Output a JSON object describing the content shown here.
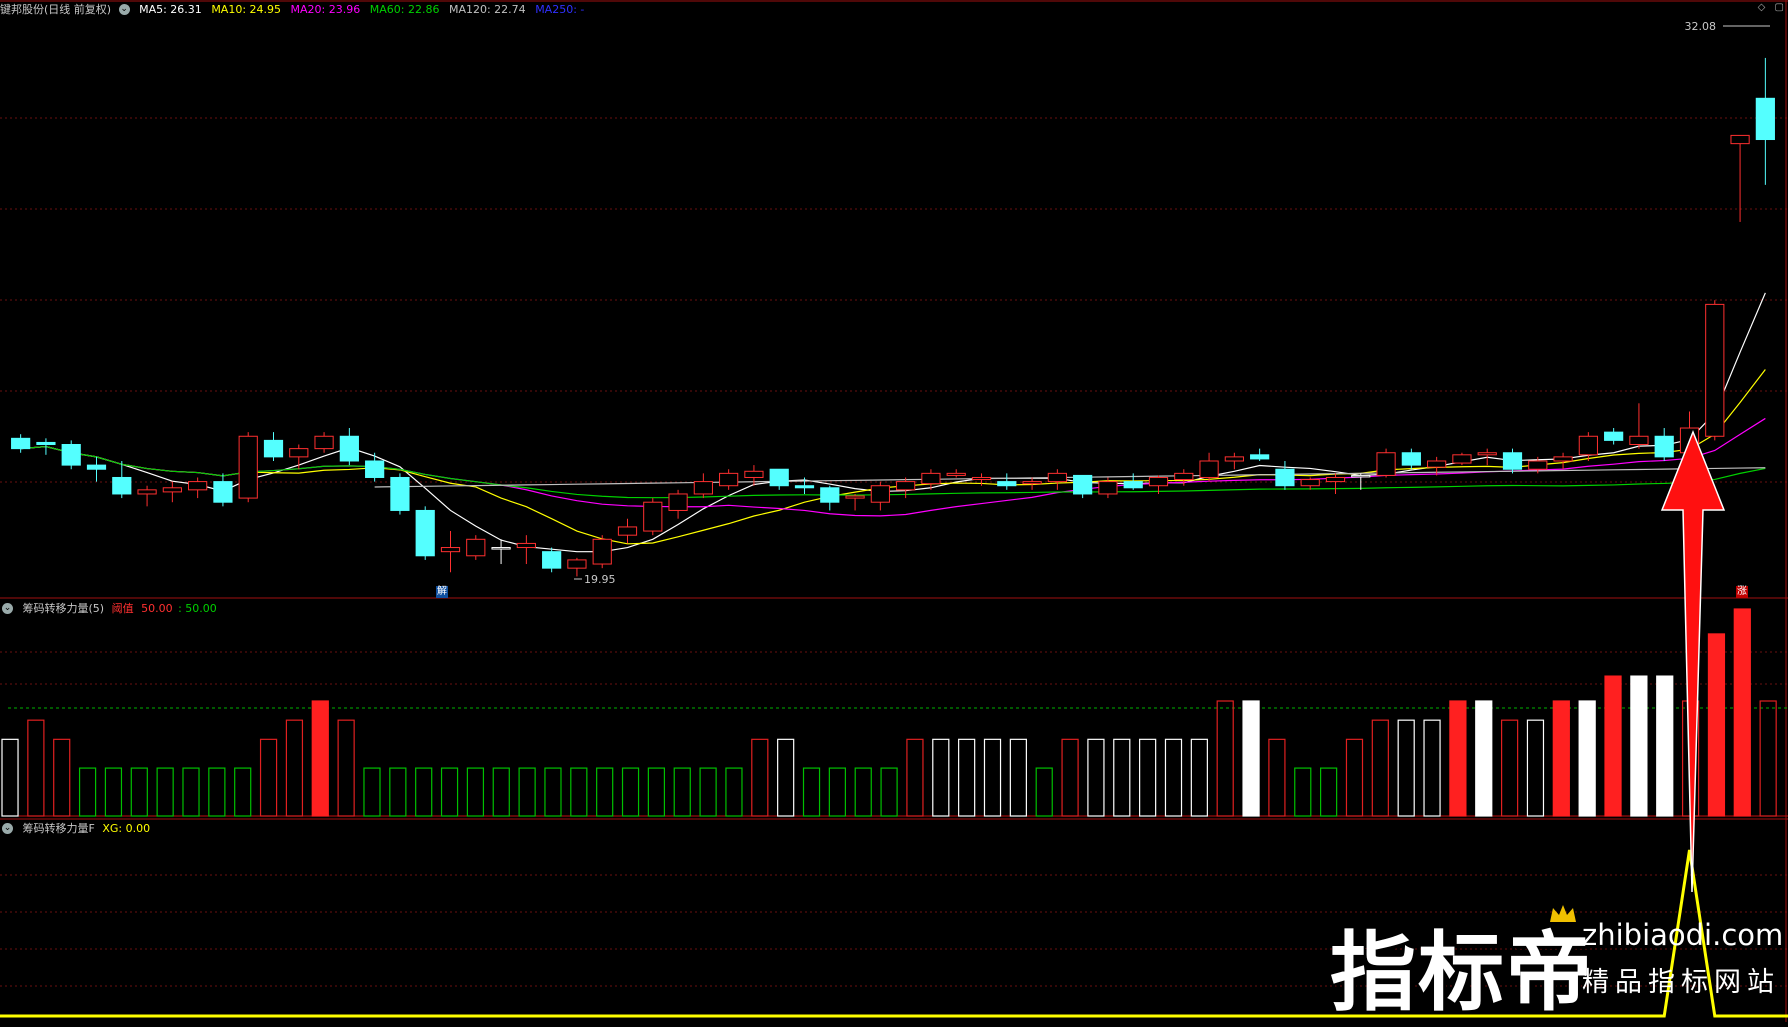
{
  "main_header": {
    "stock": "键邦股份(日线 前复权)",
    "ma5": "MA5: 26.31",
    "ma10": "MA10: 24.95",
    "ma20": "MA20: 23.96",
    "ma60": "MA60: 22.86",
    "ma120": "MA120: 22.74",
    "ma250": "MA250: -"
  },
  "price_labels": {
    "high": "32.08",
    "low": "19.95"
  },
  "markers": {
    "jie": "解",
    "zhang": "涨"
  },
  "ind1_header": {
    "name": "筹码转移力量(5)",
    "key": "阈值",
    "value_red": "50.00",
    "value_green": ": 50.00"
  },
  "ind2_header": {
    "name": "筹码转移力量F",
    "xg": "XG: 0.00"
  },
  "watermark": {
    "title": "指标帝",
    "url": "zhibiaodi.com",
    "sub": "精品指标网站"
  },
  "colors": {
    "up": "#ff3030",
    "down": "#54ffff",
    "ma5": "#ffffff",
    "ma10": "#ffff00",
    "ma20": "#ff00ff",
    "ma60": "#00d000",
    "ma120": "#c0c0c0",
    "ma250": "#3030ff"
  },
  "chart_data": [
    {
      "type": "candlestick",
      "title": "键邦股份(日线 前复权)",
      "y_range": [
        19.0,
        33.0
      ],
      "ohlc": [
        [
          22.85,
          22.95,
          22.5,
          22.6
        ],
        [
          22.75,
          22.85,
          22.45,
          22.7
        ],
        [
          22.7,
          22.8,
          22.1,
          22.2
        ],
        [
          22.2,
          22.4,
          21.8,
          22.1
        ],
        [
          21.9,
          22.3,
          21.4,
          21.5
        ],
        [
          21.5,
          21.7,
          21.2,
          21.6
        ],
        [
          21.55,
          21.8,
          21.3,
          21.65
        ],
        [
          21.6,
          21.9,
          21.4,
          21.8
        ],
        [
          21.8,
          22.0,
          21.2,
          21.3
        ],
        [
          21.4,
          23.0,
          21.3,
          22.9
        ],
        [
          22.8,
          23.0,
          22.3,
          22.4
        ],
        [
          22.4,
          22.7,
          22.1,
          22.6
        ],
        [
          22.6,
          23.0,
          22.5,
          22.9
        ],
        [
          22.9,
          23.1,
          22.2,
          22.3
        ],
        [
          22.3,
          22.5,
          21.8,
          21.9
        ],
        [
          21.9,
          22.0,
          21.0,
          21.1
        ],
        [
          21.1,
          21.2,
          19.9,
          20.0
        ],
        [
          20.1,
          20.6,
          19.6,
          20.2
        ],
        [
          20.0,
          20.5,
          19.9,
          20.4
        ],
        [
          20.2,
          20.4,
          19.8,
          20.2
        ],
        [
          20.2,
          20.5,
          19.8,
          20.3
        ],
        [
          20.1,
          20.2,
          19.6,
          19.7
        ],
        [
          19.7,
          19.95,
          19.5,
          19.9
        ],
        [
          19.8,
          20.5,
          19.7,
          20.4
        ],
        [
          20.5,
          20.9,
          20.3,
          20.7
        ],
        [
          20.6,
          21.4,
          20.5,
          21.3
        ],
        [
          21.1,
          21.6,
          20.9,
          21.5
        ],
        [
          21.5,
          22.0,
          21.4,
          21.8
        ],
        [
          21.7,
          22.1,
          21.6,
          22.0
        ],
        [
          21.9,
          22.2,
          21.7,
          22.05
        ],
        [
          22.1,
          22.0,
          21.6,
          21.7
        ],
        [
          21.7,
          21.9,
          21.5,
          21.65
        ],
        [
          21.65,
          21.7,
          21.1,
          21.3
        ],
        [
          21.4,
          21.5,
          21.1,
          21.45
        ],
        [
          21.3,
          21.8,
          21.1,
          21.7
        ],
        [
          21.6,
          21.9,
          21.4,
          21.8
        ],
        [
          21.75,
          22.1,
          21.6,
          22.0
        ],
        [
          21.95,
          22.1,
          21.9,
          22.0
        ],
        [
          21.85,
          22.0,
          21.7,
          21.9
        ],
        [
          21.8,
          22.0,
          21.6,
          21.7
        ],
        [
          21.75,
          21.9,
          21.6,
          21.8
        ],
        [
          21.8,
          22.1,
          21.6,
          22.0
        ],
        [
          21.95,
          21.9,
          21.4,
          21.5
        ],
        [
          21.5,
          21.9,
          21.4,
          21.8
        ],
        [
          21.8,
          22.0,
          21.6,
          21.65
        ],
        [
          21.7,
          21.95,
          21.5,
          21.9
        ],
        [
          21.85,
          22.1,
          21.7,
          22.0
        ],
        [
          21.9,
          22.5,
          21.8,
          22.3
        ],
        [
          22.3,
          22.5,
          22.1,
          22.4
        ],
        [
          22.45,
          22.6,
          22.3,
          22.35
        ],
        [
          22.1,
          22.3,
          21.6,
          21.7
        ],
        [
          21.7,
          21.9,
          21.6,
          21.85
        ],
        [
          21.8,
          22.0,
          21.5,
          21.9
        ],
        [
          21.95,
          22.0,
          21.6,
          21.95
        ],
        [
          21.95,
          22.6,
          21.9,
          22.5
        ],
        [
          22.5,
          22.6,
          22.1,
          22.2
        ],
        [
          22.15,
          22.4,
          21.95,
          22.3
        ],
        [
          22.25,
          22.5,
          22.2,
          22.45
        ],
        [
          22.45,
          22.6,
          22.2,
          22.5
        ],
        [
          22.5,
          22.6,
          22.0,
          22.1
        ],
        [
          22.1,
          22.4,
          22.0,
          22.3
        ],
        [
          22.3,
          22.5,
          22.1,
          22.4
        ],
        [
          22.45,
          23.0,
          22.3,
          22.9
        ],
        [
          23.0,
          23.1,
          22.7,
          22.8
        ],
        [
          22.7,
          23.7,
          22.6,
          22.9
        ],
        [
          22.9,
          23.1,
          22.3,
          22.4
        ],
        [
          22.5,
          23.5,
          22.3,
          23.1
        ],
        [
          22.9,
          26.2,
          22.8,
          26.1
        ],
        [
          30.0,
          30.1,
          28.1,
          30.2
        ],
        [
          31.1,
          32.08,
          29.0,
          30.1
        ]
      ]
    },
    {
      "type": "bar",
      "title": "筹码转移力量(5)",
      "threshold": 50.0,
      "bars": [
        [
          "w",
          40
        ],
        [
          "r",
          50
        ],
        [
          "r",
          40
        ],
        [
          "g",
          25
        ],
        [
          "g",
          25
        ],
        [
          "g",
          25
        ],
        [
          "g",
          25
        ],
        [
          "g",
          25
        ],
        [
          "g",
          25
        ],
        [
          "g",
          25
        ],
        [
          "r",
          40
        ],
        [
          "r",
          50
        ],
        [
          "R",
          60
        ],
        [
          "r",
          50
        ],
        [
          "g",
          25
        ],
        [
          "g",
          25
        ],
        [
          "g",
          25
        ],
        [
          "g",
          25
        ],
        [
          "g",
          25
        ],
        [
          "g",
          25
        ],
        [
          "g",
          25
        ],
        [
          "g",
          25
        ],
        [
          "g",
          25
        ],
        [
          "g",
          25
        ],
        [
          "g",
          25
        ],
        [
          "g",
          25
        ],
        [
          "g",
          25
        ],
        [
          "g",
          25
        ],
        [
          "g",
          25
        ],
        [
          "r",
          40
        ],
        [
          "w",
          40
        ],
        [
          "g",
          25
        ],
        [
          "g",
          25
        ],
        [
          "g",
          25
        ],
        [
          "g",
          25
        ],
        [
          "r",
          40
        ],
        [
          "w",
          40
        ],
        [
          "w",
          40
        ],
        [
          "w",
          40
        ],
        [
          "w",
          40
        ],
        [
          "g",
          25
        ],
        [
          "r",
          40
        ],
        [
          "w",
          40
        ],
        [
          "w",
          40
        ],
        [
          "w",
          40
        ],
        [
          "w",
          40
        ],
        [
          "w",
          40
        ],
        [
          "r",
          60
        ],
        [
          "W",
          60
        ],
        [
          "r",
          40
        ],
        [
          "g",
          25
        ],
        [
          "g",
          25
        ],
        [
          "r",
          40
        ],
        [
          "r",
          50
        ],
        [
          "w",
          50
        ],
        [
          "w",
          50
        ],
        [
          "R",
          60
        ],
        [
          "W",
          60
        ],
        [
          "r",
          50
        ],
        [
          "w",
          50
        ],
        [
          "R",
          60
        ],
        [
          "W",
          60
        ],
        [
          "R",
          73
        ],
        [
          "W",
          73
        ],
        [
          "W",
          73
        ],
        [
          "r",
          60
        ],
        [
          "R",
          95
        ],
        [
          "R",
          108
        ],
        [
          "r",
          60
        ]
      ]
    },
    {
      "type": "line",
      "title": "筹码转移力量F",
      "series": [
        {
          "name": "XG",
          "values": [
            0,
            0,
            0,
            0,
            0,
            0,
            0,
            0,
            0,
            0,
            0,
            0,
            0,
            0,
            0,
            0,
            0,
            0,
            0,
            0,
            0,
            0,
            0,
            0,
            0,
            0,
            0,
            0,
            0,
            0,
            0,
            0,
            0,
            0,
            0,
            0,
            0,
            0,
            0,
            0,
            0,
            0,
            0,
            0,
            0,
            0,
            0,
            0,
            0,
            0,
            0,
            0,
            0,
            0,
            0,
            0,
            0,
            0,
            0,
            0,
            0,
            0,
            0,
            0,
            0,
            0,
            1,
            0,
            0,
            0
          ]
        }
      ]
    }
  ]
}
